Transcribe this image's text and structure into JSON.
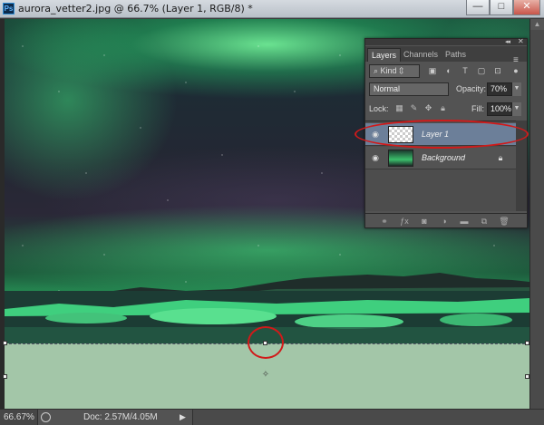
{
  "window": {
    "title": "aurora_vetter2.jpg @ 66.7% (Layer 1, RGB/8) *",
    "app_logo": "Ps",
    "minimize_icon": "—",
    "maximize_icon": "□",
    "close_icon": "✕"
  },
  "canvas": {
    "center_marker": "✧"
  },
  "status_bar": {
    "zoom": "66.67%",
    "doc_info": "Doc: 2.57M/4.05M",
    "menu_arrow": "▶"
  },
  "layers_panel": {
    "collapse_icon": "◂◂",
    "close_icon": "✕",
    "menu_icon": "≡",
    "tabs": [
      {
        "label": "Layers",
        "active": true
      },
      {
        "label": "Channels",
        "active": false
      },
      {
        "label": "Paths",
        "active": false
      }
    ],
    "filter": {
      "kind_label": "Kind",
      "icons": [
        "image-filter-icon",
        "adjustment-filter-icon",
        "type-filter-icon",
        "shape-filter-icon",
        "smart-object-filter-icon",
        "filter-toggle-icon"
      ]
    },
    "blend_mode": "Normal",
    "opacity_label": "Opacity:",
    "opacity_value": "70%",
    "lock_label": "Lock:",
    "fill_label": "Fill:",
    "fill_value": "100%",
    "layers": [
      {
        "name": "Layer 1",
        "selected": true,
        "visible": true,
        "locked": false
      },
      {
        "name": "Background",
        "selected": false,
        "visible": true,
        "locked": true
      }
    ]
  },
  "colors": {
    "highlight_annotation": "#d11a1a",
    "selected_layer": "#6c7f99",
    "layer_fill": "#a3c6a8"
  }
}
